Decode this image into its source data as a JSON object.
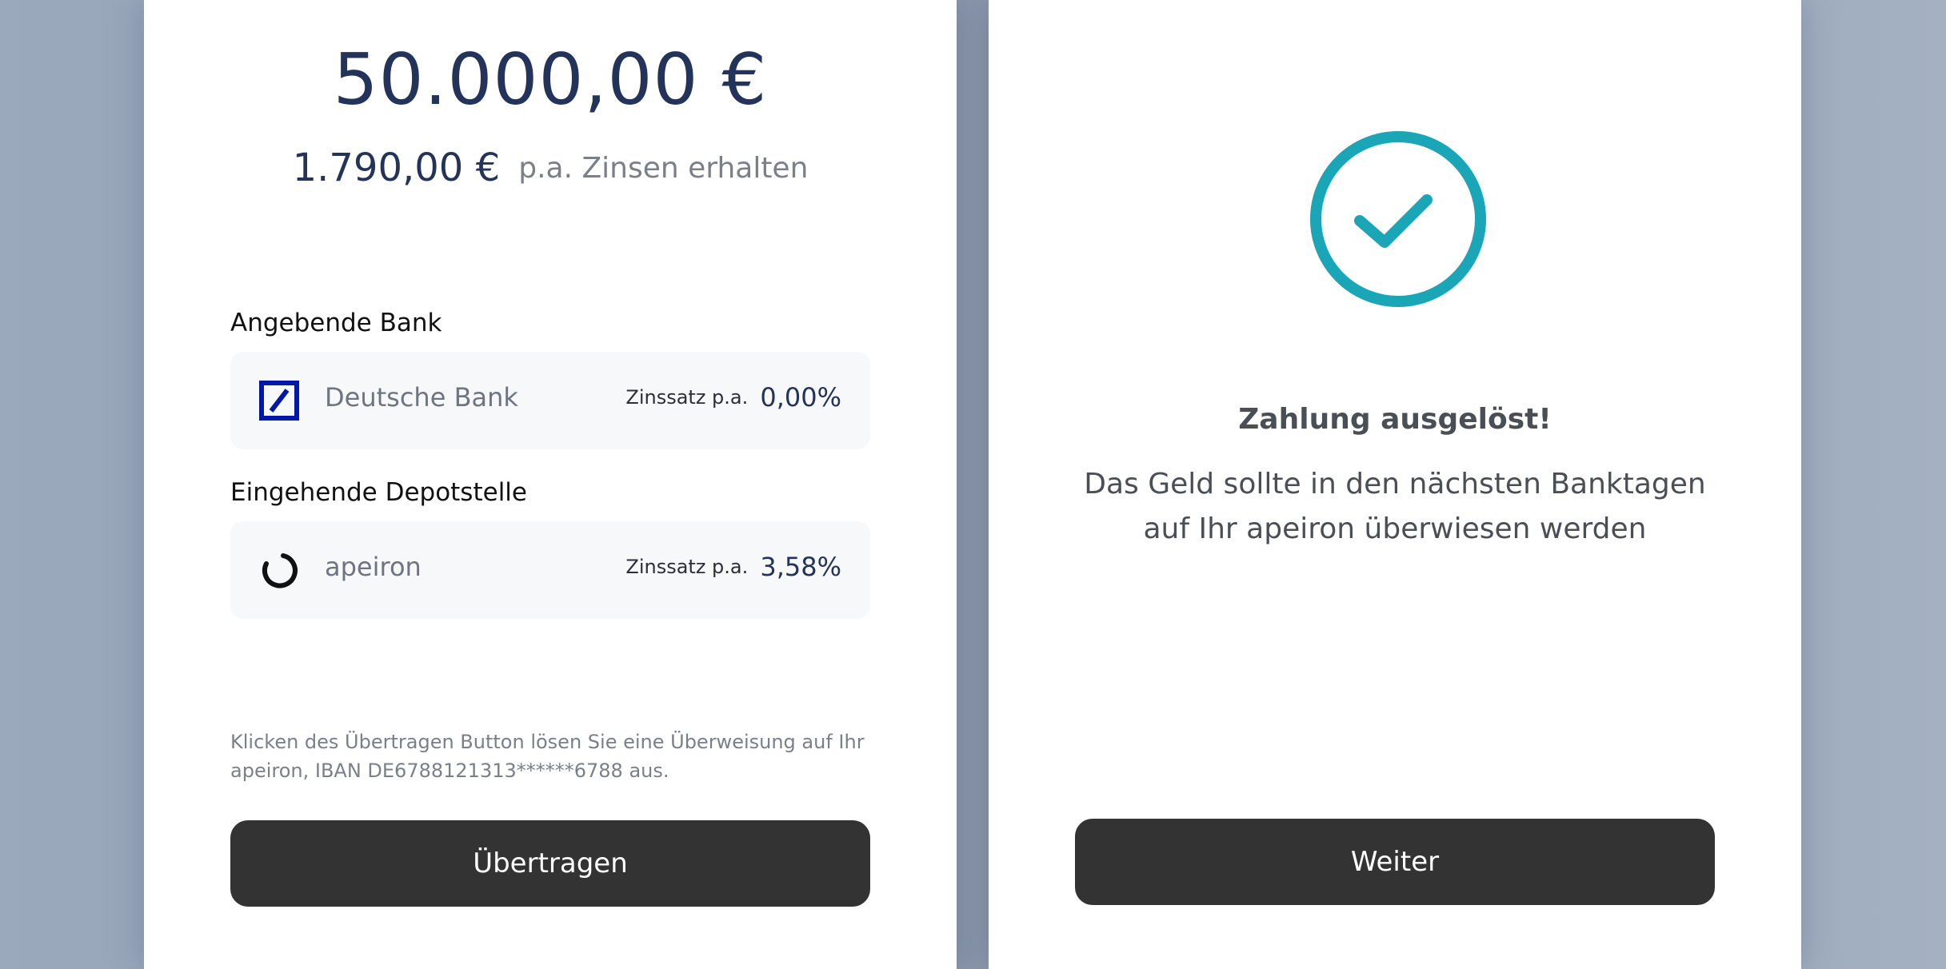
{
  "transfer": {
    "amount": "50.000,00 €",
    "interest_value": "1.790,00 €",
    "interest_label": "p.a. Zinsen erhalten"
  },
  "source": {
    "section_label": "Angebende Bank",
    "bank_name": "Deutsche Bank",
    "rate_label": "Zinssatz p.a.",
    "rate_value": "0,00%",
    "logo_icon": "deutsche-bank-logo"
  },
  "target": {
    "section_label": "Eingehende Depotstelle",
    "bank_name": "apeiron",
    "rate_label": "Zinssatz p.a.",
    "rate_value": "3,58%",
    "logo_icon": "apeiron-logo"
  },
  "disclaimer": "Klicken des Übertragen Button lösen Sie eine Überweisung auf Ihr apeiron, IBAN DE6788121313******6788 aus.",
  "transfer_button_label": "Übertragen",
  "success": {
    "icon": "check-circle-icon",
    "title": "Zahlung ausgelöst!",
    "message": "Das Geld sollte in den nächsten Banktagen auf Ihr apeiron überwiesen werden",
    "button_label": "Weiter"
  },
  "colors": {
    "accent": "#1aa6b7",
    "primary_text": "#243359",
    "button_bg": "#333333",
    "card_bg": "#f6f8fa",
    "deutsche_bank_blue": "#0018a8"
  }
}
